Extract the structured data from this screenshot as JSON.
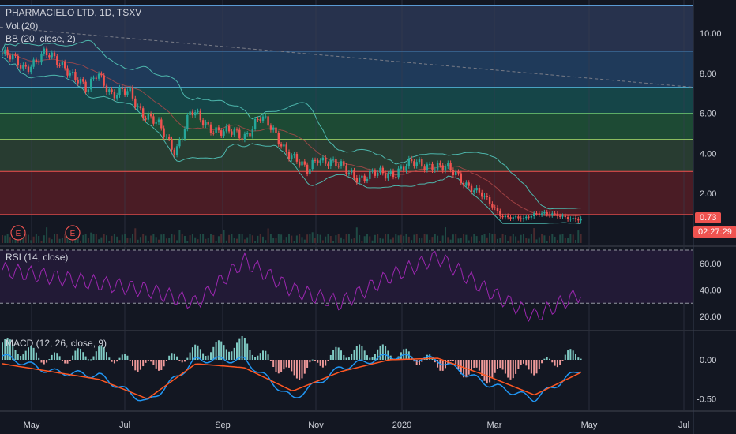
{
  "title": "PHARMACIELO LTD, 1D, TSXV",
  "indicators": {
    "vol": "Vol (20)",
    "bb": "BB (20, close, 2)",
    "rsi": "RSI (14, close)",
    "macd": "MACD (12, 26, close, 9)"
  },
  "last_price": "0.73",
  "countdown": "02:27:29",
  "earnings_marker": "E",
  "colors": {
    "bg": "#131722",
    "up": "#26a69a",
    "down": "#ef5350",
    "bb": "#4db6ac",
    "rsi": "#9c27b0",
    "macd": "#2196f3",
    "signal": "#ff5722",
    "grid": "#2a2e39"
  },
  "chart_data": [
    {
      "type": "candlestick",
      "title": "PHARMACIELO LTD, 1D, TSXV",
      "x_ticks": [
        "May",
        "Jul",
        "Sep",
        "Nov",
        "2020",
        "Mar",
        "May",
        "Jul"
      ],
      "y_ticks": [
        10.0,
        8.0,
        6.0,
        4.0,
        2.0
      ],
      "ylim": [
        0,
        11.5
      ],
      "horizontal_levels": [
        11.4,
        9.1,
        7.3,
        6.0,
        4.7,
        3.1,
        0.95
      ],
      "zones": [
        {
          "from": 9.1,
          "to": 11.4,
          "color": "#27324d"
        },
        {
          "from": 7.3,
          "to": 9.1,
          "color": "#1f3a5a"
        },
        {
          "from": 6.0,
          "to": 7.3,
          "color": "#154548"
        },
        {
          "from": 4.7,
          "to": 6.0,
          "color": "#1d4a34"
        },
        {
          "from": 3.1,
          "to": 4.7,
          "color": "#283c31"
        },
        {
          "from": 0.95,
          "to": 3.1,
          "color": "#4a1c25"
        }
      ],
      "trendline": {
        "from": [
          0,
          10.3
        ],
        "to": [
          880,
          7.3
        ]
      },
      "price_series_anchors": [
        [
          "2019-04-08",
          9.0
        ],
        [
          "2019-04-22",
          8.3
        ],
        [
          "2019-05-06",
          8.9
        ],
        [
          "2019-05-20",
          8.4
        ],
        [
          "2019-06-03",
          7.0
        ],
        [
          "2019-06-10",
          8.2
        ],
        [
          "2019-06-20",
          6.8
        ],
        [
          "2019-07-01",
          7.1
        ],
        [
          "2019-07-10",
          6.0
        ],
        [
          "2019-07-20",
          5.3
        ],
        [
          "2019-07-31",
          4.2
        ],
        [
          "2019-08-10",
          6.0
        ],
        [
          "2019-08-20",
          5.5
        ],
        [
          "2019-09-01",
          5.0
        ],
        [
          "2019-09-14",
          4.9
        ],
        [
          "2019-09-24",
          5.8
        ],
        [
          "2019-10-04",
          5.0
        ],
        [
          "2019-10-14",
          4.0
        ],
        [
          "2019-10-25",
          3.0
        ],
        [
          "2019-11-01",
          3.9
        ],
        [
          "2019-11-15",
          3.3
        ],
        [
          "2019-12-01",
          2.8
        ],
        [
          "2019-12-16",
          3.0
        ],
        [
          "2020-01-01",
          3.4
        ],
        [
          "2020-01-15",
          3.5
        ],
        [
          "2020-02-01",
          2.9
        ],
        [
          "2020-02-15",
          2.0
        ],
        [
          "2020-03-01",
          0.9
        ],
        [
          "2020-03-15",
          0.7
        ],
        [
          "2020-03-25",
          1.1
        ],
        [
          "2020-04-10",
          0.8
        ],
        [
          "2020-04-24",
          0.73
        ]
      ]
    },
    {
      "type": "line",
      "title": "RSI (14, close)",
      "y_ticks": [
        60.0,
        40.0,
        20.0
      ],
      "bands": [
        70,
        30
      ],
      "x": [
        "2019-04-15",
        "2019-05-15",
        "2019-06-15",
        "2019-07-15",
        "2019-08-15",
        "2019-09-15",
        "2019-10-15",
        "2019-11-15",
        "2019-12-15",
        "2020-01-15",
        "2020-02-15",
        "2020-03-15",
        "2020-04-15"
      ],
      "values": [
        55,
        50,
        45,
        40,
        30,
        62,
        40,
        30,
        50,
        65,
        40,
        20,
        38
      ]
    },
    {
      "type": "line",
      "title": "MACD (12, 26, close, 9)",
      "y_ticks": [
        0.0,
        -0.5
      ],
      "series": [
        {
          "name": "MACD",
          "values": [
            0.05,
            -0.15,
            -0.2,
            -0.55,
            0.0,
            0.0,
            -0.5,
            -0.1,
            0.05,
            0.0,
            -0.3,
            -0.5,
            -0.1
          ]
        },
        {
          "name": "Signal",
          "values": [
            -0.05,
            -0.15,
            -0.25,
            -0.5,
            -0.05,
            -0.1,
            -0.4,
            -0.15,
            0.0,
            0.02,
            -0.2,
            -0.45,
            -0.15
          ]
        }
      ]
    }
  ]
}
